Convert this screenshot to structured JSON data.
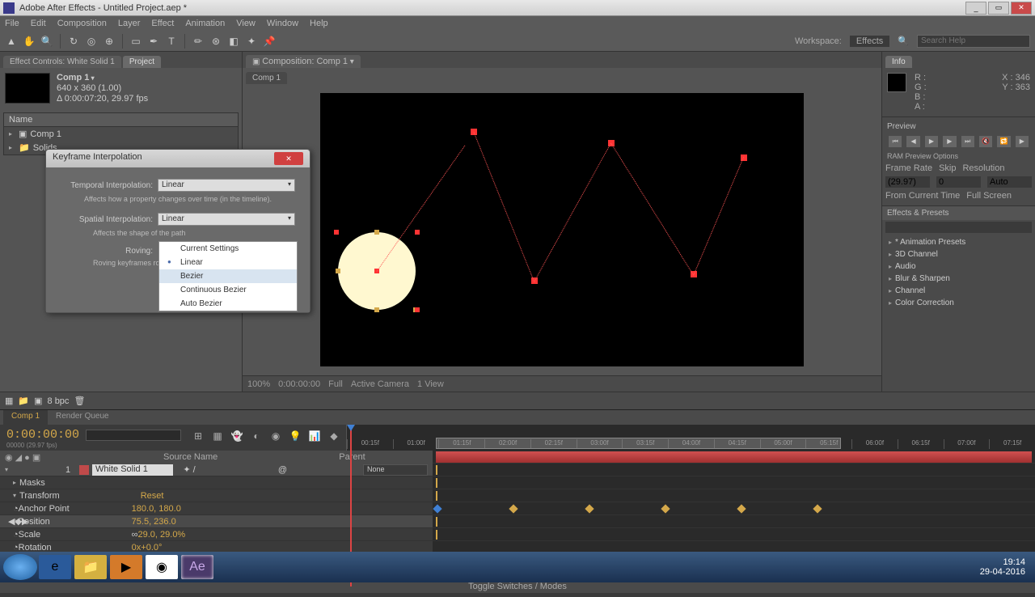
{
  "title": "Adobe After Effects - Untitled Project.aep *",
  "menu": [
    "File",
    "Edit",
    "Composition",
    "Layer",
    "Effect",
    "Animation",
    "View",
    "Window",
    "Help"
  ],
  "workspace_label": "Workspace:",
  "workspace_value": "Effects",
  "search_placeholder": "Search Help",
  "project": {
    "tab_effect": "Effect Controls: White Solid 1",
    "tab_project": "Project",
    "comp_name": "Comp 1",
    "comp_res": "640 x 360 (1.00)",
    "comp_dur": "Δ 0:00:07:20, 29.97 fps",
    "header_name": "Name",
    "rows": [
      "Comp 1",
      "Solids"
    ]
  },
  "viewer": {
    "tab_composition": "Composition: Comp 1",
    "tab_flow": "Comp 1",
    "footer_zoom": "100%",
    "footer_res": "Full",
    "footer_time": "0:00:00:00",
    "footer_camera": "Active Camera",
    "footer_view": "1 View"
  },
  "dialog": {
    "title": "Keyframe Interpolation",
    "temporal_label": "Temporal Interpolation:",
    "temporal_value": "Linear",
    "temporal_hint": "Affects how a property changes over time (in the timeline).",
    "spatial_label": "Spatial Interpolation:",
    "spatial_value": "Linear",
    "spatial_hint": "Affects the shape of the path",
    "roving_label": "Roving:",
    "roving_hint": "Roving keyframes rove",
    "options": [
      "Current Settings",
      "Linear",
      "Bezier",
      "Continuous Bezier",
      "Auto Bezier"
    ]
  },
  "info": {
    "r": "R :",
    "g": "G :",
    "b": "B :",
    "a": "A :",
    "x": "X : 346",
    "y": "Y : 363"
  },
  "preview": {
    "header": "Preview",
    "ram": "RAM Preview Options",
    "cols": [
      "Frame Rate",
      "Skip",
      "Resolution"
    ],
    "vals": [
      "(29.97)",
      "0",
      "Auto"
    ],
    "from": "From Current Time",
    "full": "Full Screen"
  },
  "effects": {
    "header": "Effects & Presets",
    "items": [
      "* Animation Presets",
      "3D Channel",
      "Audio",
      "Blur & Sharpen",
      "Channel",
      "Color Correction"
    ]
  },
  "project_footer": {
    "bpc": "8 bpc"
  },
  "timeline": {
    "tab1": "Comp 1",
    "tab2": "Render Queue",
    "timecode": "0:00:00:00",
    "timecode_sub": "00000 (29.97 fps)",
    "ticks": [
      "00:15f",
      "01:00f",
      "01:15f",
      "02:00f",
      "02:15f",
      "03:00f",
      "03:15f",
      "04:00f",
      "04:15f",
      "05:00f",
      "05:15f",
      "06:00f",
      "06:15f",
      "07:00f",
      "07:15f"
    ],
    "col_source": "Source Name",
    "col_parent": "Parent",
    "layer_num": "1",
    "layer_name": "White Solid 1",
    "parent_none": "None",
    "masks": "Masks",
    "transform": "Transform",
    "reset": "Reset",
    "anchor": "Anchor Point",
    "anchor_val": "180.0, 180.0",
    "position": "Position",
    "position_val": "75.5, 236.0",
    "scale": "Scale",
    "scale_val": "29.0, 29.0%",
    "rotation": "Rotation",
    "rotation_val": "0x+0.0°",
    "footer": "Toggle Switches / Modes"
  },
  "tray": {
    "time": "19:14",
    "date": "29-04-2016"
  }
}
